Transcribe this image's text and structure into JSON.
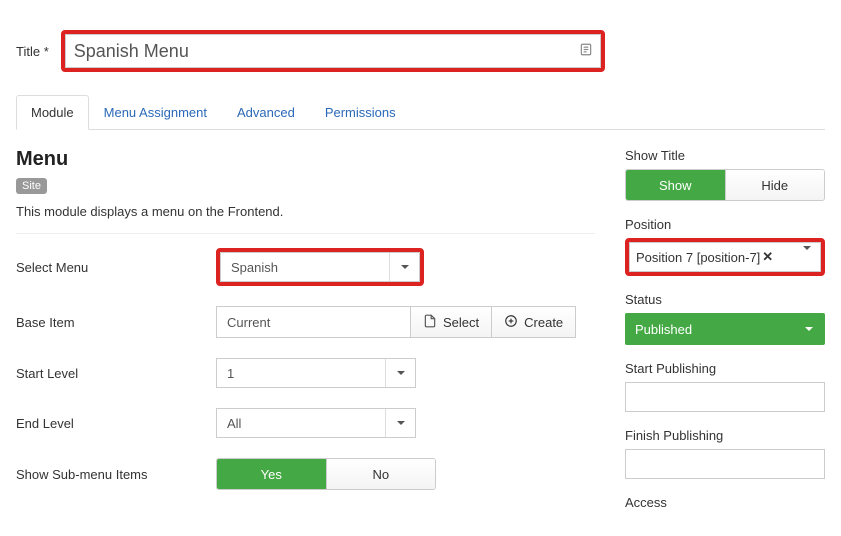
{
  "title": {
    "label": "Title *",
    "value": "Spanish Menu"
  },
  "tabs": {
    "module": "Module",
    "menu_assignment": "Menu Assignment",
    "advanced": "Advanced",
    "permissions": "Permissions"
  },
  "module": {
    "heading": "Menu",
    "badge": "Site",
    "description": "This module displays a menu on the Frontend.",
    "fields": {
      "select_menu": {
        "label": "Select Menu",
        "value": "Spanish"
      },
      "base_item": {
        "label": "Base Item",
        "value": "Current",
        "select_btn": "Select",
        "create_btn": "Create"
      },
      "start_level": {
        "label": "Start Level",
        "value": "1"
      },
      "end_level": {
        "label": "End Level",
        "value": "All"
      },
      "show_sub": {
        "label": "Show Sub-menu Items",
        "yes": "Yes",
        "no": "No"
      }
    }
  },
  "side": {
    "show_title": {
      "label": "Show Title",
      "show": "Show",
      "hide": "Hide"
    },
    "position": {
      "label": "Position",
      "value": "Position 7 [position-7]"
    },
    "status": {
      "label": "Status",
      "value": "Published"
    },
    "start_pub": {
      "label": "Start Publishing",
      "value": ""
    },
    "finish_pub": {
      "label": "Finish Publishing",
      "value": ""
    },
    "access": {
      "label": "Access"
    }
  }
}
